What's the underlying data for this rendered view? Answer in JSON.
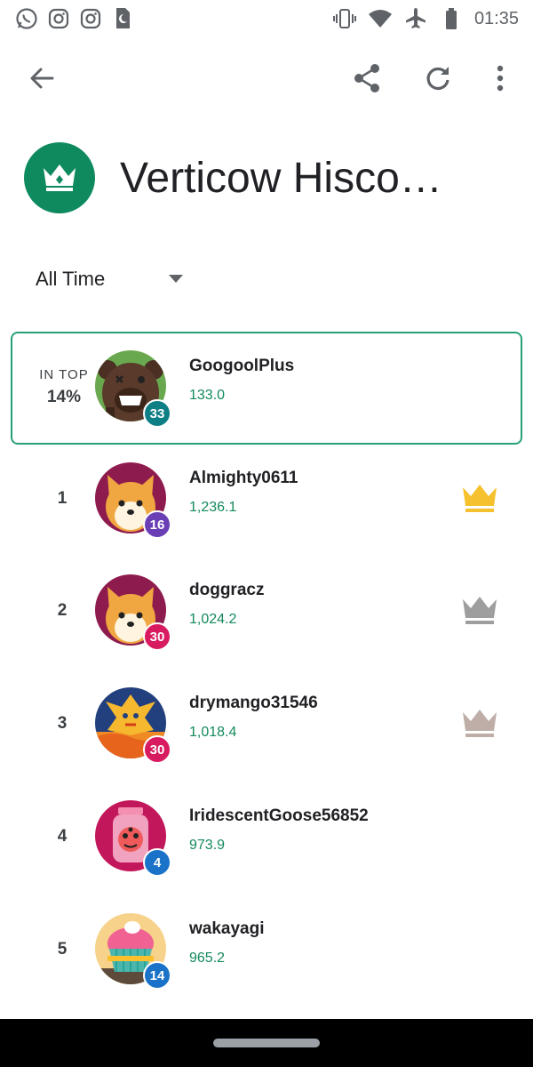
{
  "status_bar": {
    "time": "01:35",
    "left_icons": [
      "whatsapp-icon",
      "instagram-icon",
      "instagram-icon",
      "sim-card-icon"
    ],
    "right_icons": [
      "vibrate-icon",
      "wifi-icon",
      "airplane-icon",
      "battery-icon"
    ]
  },
  "app_bar": {
    "icons": [
      "arrow-back-icon",
      "share-icon",
      "refresh-icon",
      "more-vert-icon"
    ]
  },
  "header": {
    "title": "Verticow Hisco…",
    "badge_icon": "crown-icon",
    "badge_color": "#0f8a5f"
  },
  "filter": {
    "selected": "All Time"
  },
  "player": {
    "rank_label": "IN TOP",
    "rank_value": "14%",
    "name": "GoogoolPlus",
    "score": "133.0",
    "level": "33",
    "level_color": "#0f7f86",
    "avatar": "bear-avatar"
  },
  "leaderboard": [
    {
      "rank": "1",
      "name": "Almighty0611",
      "score": "1,236.1",
      "level": "16",
      "level_color": "#6a3fb5",
      "avatar": "shiba-avatar",
      "crown": "gold-crown-icon",
      "crown_color": "#f6c12e"
    },
    {
      "rank": "2",
      "name": "doggracz",
      "score": "1,024.2",
      "level": "30",
      "level_color": "#d81b60",
      "avatar": "shiba-avatar",
      "crown": "silver-crown-icon",
      "crown_color": "#9e9e9e"
    },
    {
      "rank": "3",
      "name": "drymango31546",
      "score": "1,018.4",
      "level": "30",
      "level_color": "#d81b60",
      "avatar": "phoenix-avatar",
      "crown": "bronze-crown-icon",
      "crown_color": "#bfaea8"
    },
    {
      "rank": "4",
      "name": "IridescentGoose56852",
      "score": "973.9",
      "level": "4",
      "level_color": "#1a73c8",
      "avatar": "jar-monster-avatar"
    },
    {
      "rank": "5",
      "name": "wakayagi",
      "score": "965.2",
      "level": "14",
      "level_color": "#1a73c8",
      "avatar": "cupcake-avatar"
    }
  ],
  "colors": {
    "accent_green": "#138a5b",
    "card_border": "#27a07a"
  }
}
